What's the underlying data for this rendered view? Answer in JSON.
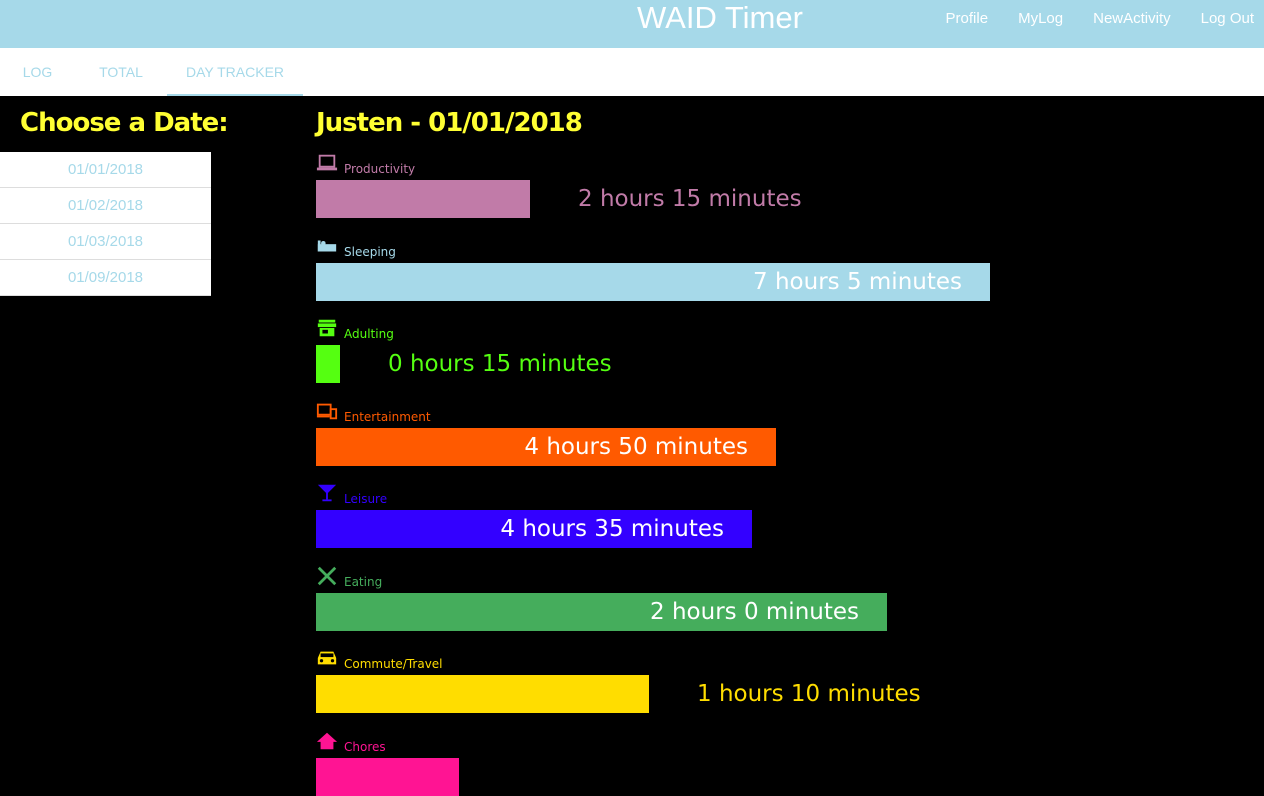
{
  "app": {
    "title": "WAID Timer",
    "nav": [
      "Profile",
      "MyLog",
      "NewActivity",
      "Log Out"
    ]
  },
  "tabs": [
    "LOG",
    "TOTAL",
    "DAY TRACKER"
  ],
  "active_tab": "DAY TRACKER",
  "sidebar": {
    "title": "Choose a Date:",
    "dates": [
      "01/01/2018",
      "01/02/2018",
      "01/03/2018",
      "01/09/2018"
    ]
  },
  "main": {
    "heading": "Justen - 01/01/2018"
  },
  "activities": [
    {
      "name": "Productivity",
      "icon": "laptop-icon",
      "color": "#c17ba8",
      "duration": "2 hours 15 minutes",
      "minutes": 135
    },
    {
      "name": "Sleeping",
      "icon": "bed-icon",
      "color": "#a6d9e9",
      "duration": "7 hours 5 minutes",
      "minutes": 425
    },
    {
      "name": "Adulting",
      "icon": "store-icon",
      "color": "#55ff11",
      "duration": "0 hours 15 minutes",
      "minutes": 15
    },
    {
      "name": "Entertainment",
      "icon": "devices-icon",
      "color": "#ff5a00",
      "duration": "4 hours 50 minutes",
      "minutes": 290
    },
    {
      "name": "Leisure",
      "icon": "cocktail-icon",
      "color": "#3300ff",
      "duration": "4 hours 35 minutes",
      "minutes": 275
    },
    {
      "name": "Eating",
      "icon": "utensils-icon",
      "color": "#45ad5c",
      "duration": "2 hours 0 minutes",
      "minutes": 360
    },
    {
      "name": "Commute/Travel",
      "icon": "car-icon",
      "color": "#ffdd00",
      "duration": "1 hours 10 minutes",
      "minutes": 210
    },
    {
      "name": "Chores",
      "icon": "home-icon",
      "color": "#ff1493",
      "duration": "",
      "minutes": 90
    }
  ]
}
